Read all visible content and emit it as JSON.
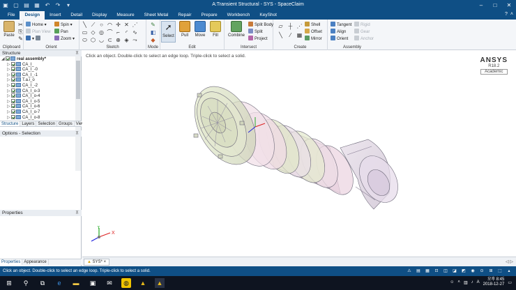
{
  "app": {
    "title": "A:Transient Structural - SYS - SpaceClaim"
  },
  "qat_icons": [
    "app-icon",
    "new-icon",
    "open-icon",
    "save-icon",
    "undo-icon",
    "redo-icon",
    "dropdown-icon"
  ],
  "tabs": [
    {
      "label": "File"
    },
    {
      "label": "Design",
      "active": true
    },
    {
      "label": "Insert"
    },
    {
      "label": "Detail"
    },
    {
      "label": "Display"
    },
    {
      "label": "Measure"
    },
    {
      "label": "Sheet Metal"
    },
    {
      "label": "Repair"
    },
    {
      "label": "Prepare"
    },
    {
      "label": "Workbench"
    },
    {
      "label": "KeyShot"
    }
  ],
  "ribbon": {
    "clipboard": {
      "label": "Clipboard",
      "paste": "Paste"
    },
    "orient": {
      "label": "Orient",
      "home": "Home",
      "plan_view": "Plan View",
      "spin": "Spin",
      "pan": "Pan",
      "zoom": "Zoom"
    },
    "sketch": {
      "label": "Sketch"
    },
    "mode": {
      "label": "Mode"
    },
    "edit": {
      "label": "Edit",
      "select": "Select",
      "pull": "Pull",
      "move": "Move",
      "fill": "Fill"
    },
    "intersect": {
      "label": "Intersect",
      "combine": "Combine",
      "split_body": "Split Body",
      "split": "Split",
      "project": "Project"
    },
    "create": {
      "label": "Create",
      "shell": "Shell",
      "offset": "Offset",
      "mirror": "Mirror"
    },
    "assembly": {
      "label": "Assembly",
      "tangent": "Tangent",
      "align": "Align",
      "orient": "Orient",
      "rigid": "Rigid",
      "gear": "Gear",
      "anchor": "Anchor"
    }
  },
  "structure": {
    "header": "Structure",
    "items": [
      {
        "label": "real assembly*",
        "root": true
      },
      {
        "label": "CA_I_"
      },
      {
        "label": "CA_I_-0"
      },
      {
        "label": "CA_I_-1"
      },
      {
        "label": "T.a.i_o"
      },
      {
        "label": "CA_I_-2"
      },
      {
        "label": "CA_I_o-3"
      },
      {
        "label": "CA_I_o-4"
      },
      {
        "label": "CA_I_o-5"
      },
      {
        "label": "CA_I_o-6"
      },
      {
        "label": "CA_I_o-7"
      },
      {
        "label": "CA_I_o-8"
      }
    ],
    "tabs": [
      "Structure",
      "Layers",
      "Selection",
      "Groups",
      "Views"
    ]
  },
  "options": {
    "header": "Options - Selection"
  },
  "properties": {
    "header": "Properties",
    "tabs": [
      "Properties",
      "Appearance"
    ]
  },
  "viewport": {
    "hint": "Click an object. Double-click to select an edge loop. Triple-click to select a solid.",
    "logo": {
      "brand": "ANSYS",
      "version": "R18.2",
      "edition": "Academic"
    },
    "axes": {
      "x": "X",
      "y": "Y"
    }
  },
  "doc_tab": {
    "label": "SYS*",
    "close": "×"
  },
  "status": {
    "text": "Click an object. Double-click to select an edge loop. Triple-click to select a solid."
  },
  "taskbar": {
    "time": "오후 8:45",
    "date": "2018-12-27",
    "lang": "A"
  }
}
